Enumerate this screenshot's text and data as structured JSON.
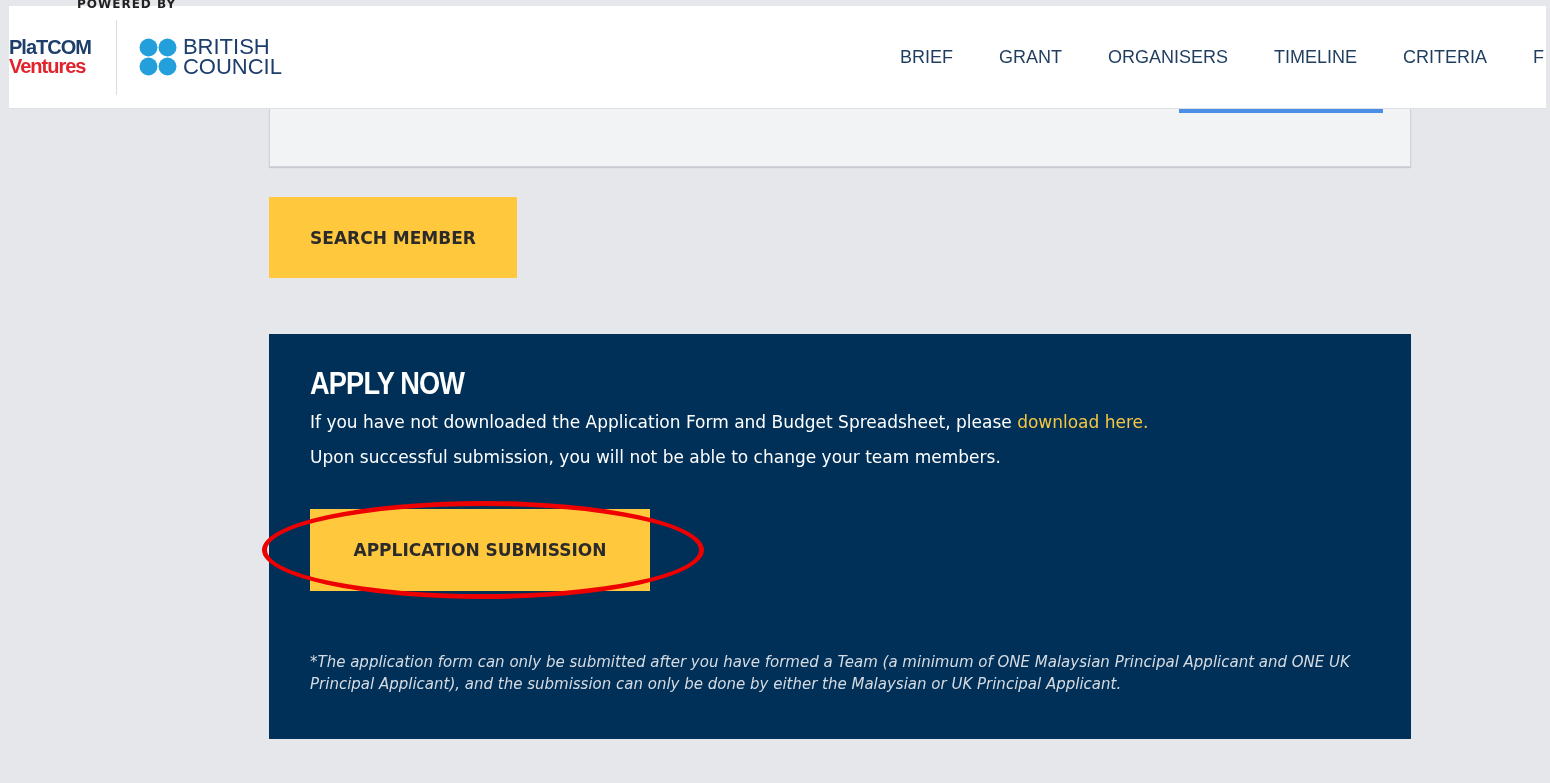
{
  "header": {
    "powered_by": "POWERED BY",
    "logo_primary": {
      "line_1": "PlaTCOM",
      "line_2": "Ventures"
    },
    "logo_partner": {
      "line_1": "BRITISH",
      "line_2": "COUNCIL"
    },
    "nav": [
      {
        "label": "BRIEF"
      },
      {
        "label": "GRANT"
      },
      {
        "label": "ORGANISERS"
      },
      {
        "label": "TIMELINE"
      },
      {
        "label": "CRITERIA"
      },
      {
        "label": "F"
      }
    ]
  },
  "search_button": "SEARCH MEMBER",
  "apply": {
    "title": "APPLY NOW",
    "intro": "If you have not downloaded the Application Form and Budget Spreadsheet, please",
    "link": "download here.",
    "notice": "Upon successful submission, you will not be able to change your team members.",
    "button": "APPLICATION SUBMISSION",
    "highlighted": true,
    "footnote": "*The application form can only be submitted after you have formed a Team (a minimum of ONE Malaysian Principal Applicant and ONE UK Principal Applicant), and the submission can only be done by either the Malaysian or UK Principal Applicant."
  }
}
